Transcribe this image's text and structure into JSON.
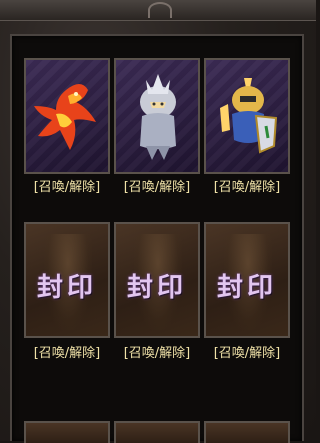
{
  "pets": [
    {
      "name": "phoenix",
      "state": "unlocked",
      "action_label": "[召喚/解除]"
    },
    {
      "name": "silver-warrior",
      "state": "unlocked",
      "action_label": "[召喚/解除]"
    },
    {
      "name": "golden-knight",
      "state": "unlocked",
      "action_label": "[召喚/解除]"
    },
    {
      "name": "sealed-1",
      "state": "sealed",
      "seal_text": "封印",
      "action_label": "[召喚/解除]"
    },
    {
      "name": "sealed-2",
      "state": "sealed",
      "seal_text": "封印",
      "action_label": "[召喚/解除]"
    },
    {
      "name": "sealed-3",
      "state": "sealed",
      "seal_text": "封印",
      "action_label": "[召喚/解除]"
    }
  ],
  "colors": {
    "label": "#f0e2a8",
    "seal": "#e2c6f0",
    "slot_border": "#5a524b"
  }
}
